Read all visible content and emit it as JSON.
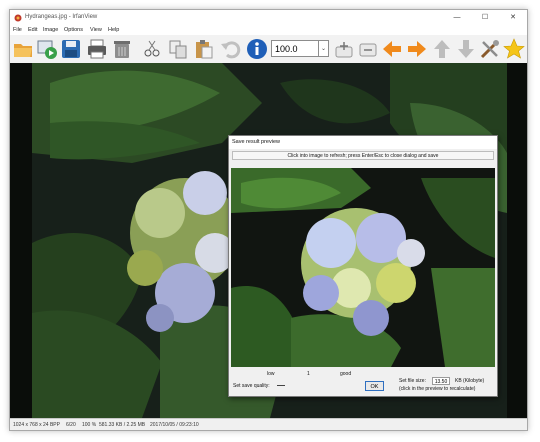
{
  "window": {
    "title": "Hydrangeas.jpg - IrfanView",
    "minimize_glyph": "—",
    "maximize_glyph": "☐",
    "close_glyph": "✕"
  },
  "menu": [
    "File",
    "Edit",
    "Image",
    "Options",
    "View",
    "Help"
  ],
  "toolbar": {
    "icons": [
      "open-folder-icon",
      "slideshow-icon",
      "save-icon",
      "print-icon",
      "delete-icon",
      "cut-icon",
      "copy-icon",
      "paste-icon",
      "undo-icon",
      "info-icon",
      "zoom-in-icon",
      "zoom-out-icon",
      "previous-icon",
      "next-icon",
      "first-icon",
      "last-icon",
      "tools-icon",
      "favorite-icon"
    ],
    "zoom_value": "100.0",
    "zoom_arrow": "⌄"
  },
  "dialog": {
    "title": "Save result preview",
    "hint": "Click into image to refresh; press Enter/Esc to close dialog and save",
    "quality_low": "low",
    "quality_value": "1",
    "quality_good": "good",
    "quality_label": "Set save quality:",
    "ok_label": "OK",
    "size_label": "Set file size:",
    "size_value": "13.50",
    "size_unit": "KB (Kilobyte)",
    "size_note": "(click in the preview to recalculate)"
  },
  "status": {
    "dimensions": "1024 x 768 x 24 BPP",
    "index": "6/20",
    "zoom": "100 %",
    "filesize": "581.33 KB / 2.25 MB",
    "datetime": "2017/10/05 / 09:23:10"
  },
  "colors": {
    "accent_blue": "#2f6fc0",
    "window_bg": "#f0f0f0",
    "dark_leaf": "#1e3a1a"
  }
}
